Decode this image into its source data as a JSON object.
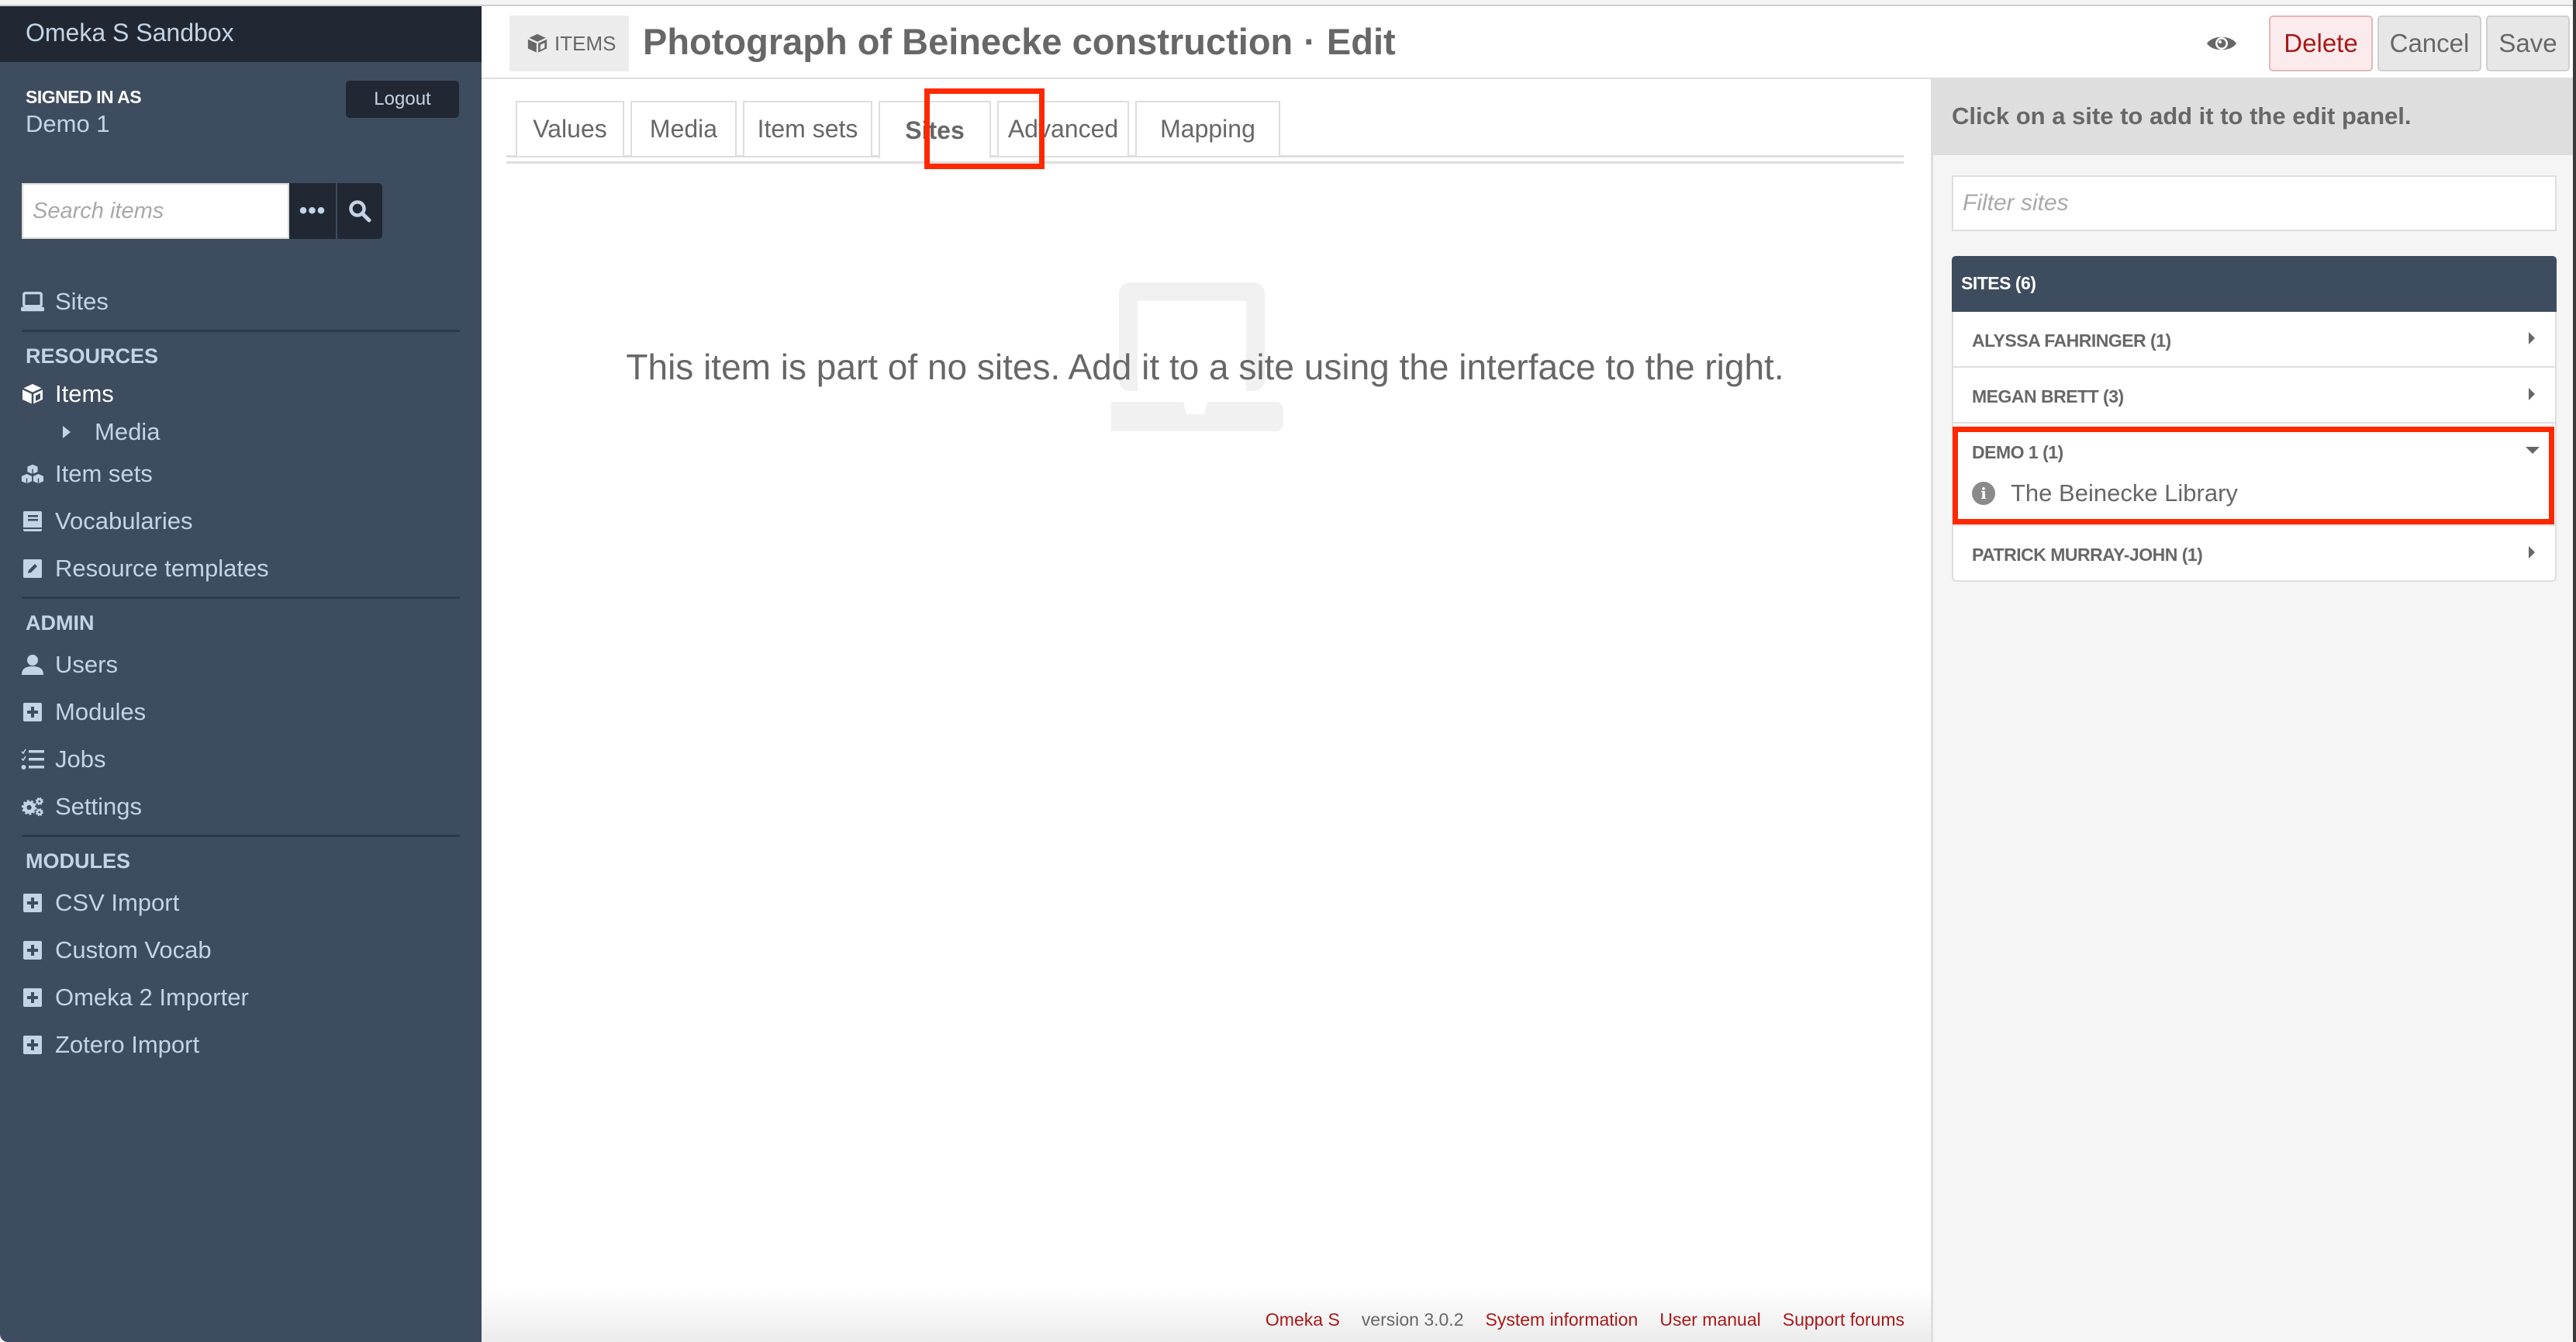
{
  "app": {
    "brand": "Omeka S Sandbox"
  },
  "user": {
    "signed_in_label": "SIGNED IN AS",
    "name": "Demo 1",
    "logout_label": "Logout"
  },
  "sidebar_search": {
    "placeholder": "Search items",
    "value": "",
    "more_icon": "ellipsis-icon",
    "search_icon": "search-icon"
  },
  "sidebar": {
    "top_items": [
      {
        "label": "Sites",
        "icon": "laptop-icon"
      }
    ],
    "sections": [
      {
        "heading": "RESOURCES",
        "items": [
          {
            "label": "Items",
            "icon": "cube-icon",
            "active": true
          },
          {
            "label": "Media",
            "icon": "caret-right-icon",
            "sub": true
          },
          {
            "label": "Item sets",
            "icon": "cubes-icon"
          },
          {
            "label": "Vocabularies",
            "icon": "book-icon"
          },
          {
            "label": "Resource templates",
            "icon": "edit-square-icon"
          }
        ]
      },
      {
        "heading": "ADMIN",
        "items": [
          {
            "label": "Users",
            "icon": "user-icon"
          },
          {
            "label": "Modules",
            "icon": "plus-square-icon"
          },
          {
            "label": "Jobs",
            "icon": "tasks-icon"
          },
          {
            "label": "Settings",
            "icon": "cogs-icon"
          }
        ]
      },
      {
        "heading": "MODULES",
        "items": [
          {
            "label": "CSV Import",
            "icon": "plus-square-icon"
          },
          {
            "label": "Custom Vocab",
            "icon": "plus-square-icon"
          },
          {
            "label": "Omeka 2 Importer",
            "icon": "plus-square-icon"
          },
          {
            "label": "Zotero Import",
            "icon": "plus-square-icon"
          }
        ]
      }
    ]
  },
  "header": {
    "resource_type": "ITEMS",
    "title": "Photograph of Beinecke construction",
    "separator": "·",
    "action": "Edit",
    "view_icon": "eye-icon",
    "delete_label": "Delete",
    "cancel_label": "Cancel",
    "save_label": "Save"
  },
  "tabs": [
    {
      "label": "Values",
      "active": false
    },
    {
      "label": "Media",
      "active": false
    },
    {
      "label": "Item sets",
      "active": false
    },
    {
      "label": "Sites",
      "active": true
    },
    {
      "label": "Advanced",
      "active": false
    },
    {
      "label": "Mapping",
      "active": false
    }
  ],
  "main": {
    "empty_icon": "laptop-icon",
    "empty_message": "This item is part of no sites. Add it to a site using the interface to the right."
  },
  "panel": {
    "instruction": "Click on a site to add it to the edit panel.",
    "filter_placeholder": "Filter sites",
    "filter_value": "",
    "sites_header": "SITES (6)",
    "site_groups": [
      {
        "name": "ALYSSA FAHRINGER (1)",
        "expanded": false,
        "sites": []
      },
      {
        "name": "MEGAN BRETT (3)",
        "expanded": false,
        "sites": []
      },
      {
        "name": "DEMO 1 (1)",
        "expanded": true,
        "sites": [
          {
            "title": "The Beinecke Library",
            "icon": "info-circle-icon"
          }
        ]
      },
      {
        "name": "PATRICK MURRAY-JOHN (1)",
        "expanded": false,
        "sites": []
      }
    ]
  },
  "footer": {
    "product": "Omeka S",
    "version": "version 3.0.2",
    "links": [
      "System information",
      "User manual",
      "Support forums"
    ]
  },
  "colors": {
    "sidebar_bg": "#3e4c5f",
    "sidebar_dark": "#212833",
    "sidebar_text": "#c4d3e6",
    "accent_red": "#a91919",
    "annotation_red": "#ff2800",
    "text_grey": "#676767"
  }
}
